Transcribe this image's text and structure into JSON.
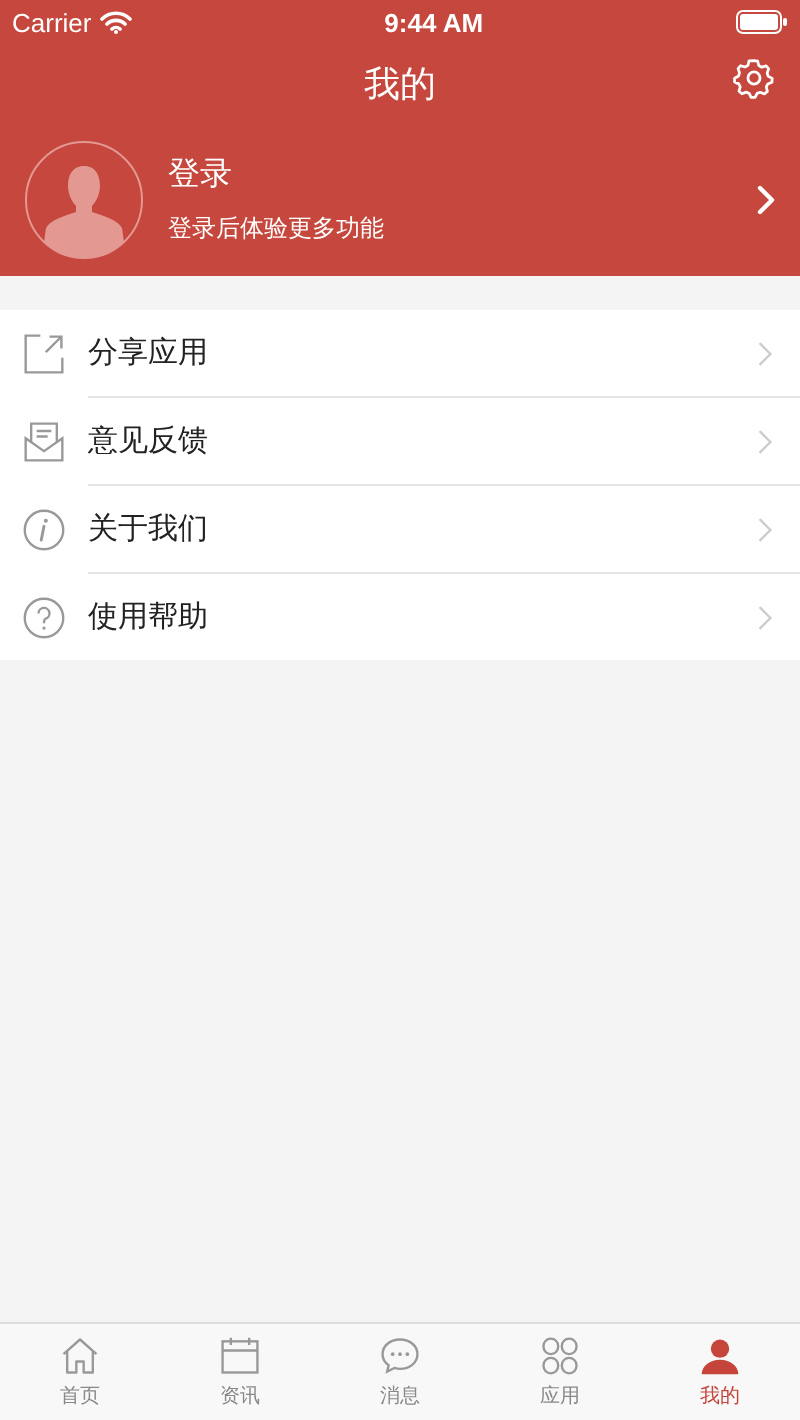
{
  "status_bar": {
    "carrier": "Carrier",
    "time": "9:44 AM"
  },
  "nav": {
    "title": "我的"
  },
  "profile": {
    "name": "登录",
    "subtitle": "登录后体验更多功能"
  },
  "menu": [
    {
      "kind": "share",
      "label": "分享应用"
    },
    {
      "kind": "feedback",
      "label": "意见反馈"
    },
    {
      "kind": "about",
      "label": "关于我们"
    },
    {
      "kind": "help",
      "label": "使用帮助"
    }
  ],
  "tab_bar": [
    {
      "kind": "home",
      "label": "首页",
      "selected": false
    },
    {
      "kind": "news",
      "label": "资讯",
      "selected": false
    },
    {
      "kind": "message",
      "label": "消息",
      "selected": false
    },
    {
      "kind": "apps",
      "label": "应用",
      "selected": false
    },
    {
      "kind": "me",
      "label": "我的",
      "selected": true
    }
  ]
}
